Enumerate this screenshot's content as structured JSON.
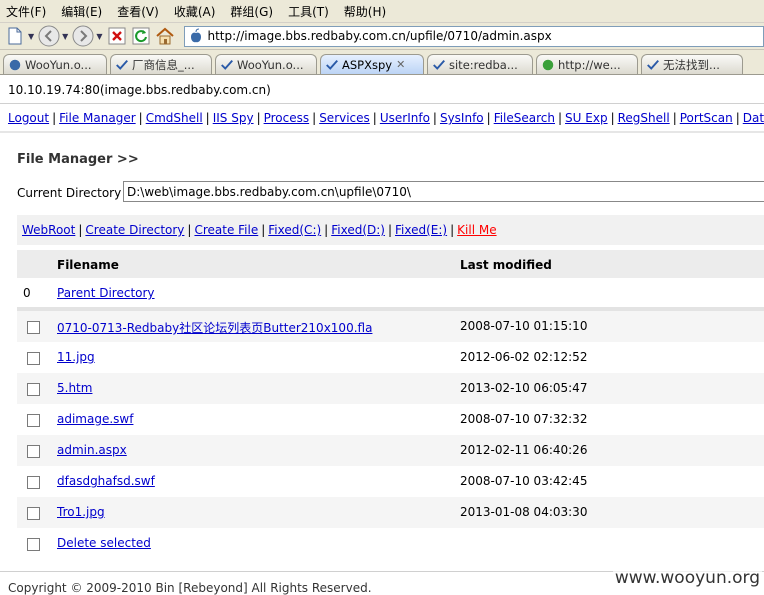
{
  "menu": [
    "文件(F)",
    "编辑(E)",
    "查看(V)",
    "收藏(A)",
    "群组(G)",
    "工具(T)",
    "帮助(H)"
  ],
  "address": {
    "url": "http://image.bbs.redbaby.com.cn/upfile/0710/admin.aspx"
  },
  "tabs": [
    {
      "label": "WooYun.o...",
      "active": false
    },
    {
      "label": "厂商信息_...",
      "active": false
    },
    {
      "label": "WooYun.o...",
      "active": false
    },
    {
      "label": "ASPXspy",
      "active": true
    },
    {
      "label": "site:redba...",
      "active": false
    },
    {
      "label": "http://we...",
      "active": false
    },
    {
      "label": "无法找到...",
      "active": false
    }
  ],
  "host": "10.10.19.74:80(image.bbs.redbaby.com.cn)",
  "nav": [
    "Logout",
    "File Manager",
    "CmdShell",
    "IIS Spy",
    "Process",
    "Services",
    "UserInfo",
    "SysInfo",
    "FileSearch",
    "SU Exp",
    "RegShell",
    "PortScan",
    "DataBase"
  ],
  "fm": {
    "title": "File Manager >>",
    "current_dir_label": "Current Directory :",
    "current_dir_value": "D:\\web\\image.bbs.redbaby.com.cn\\upfile\\0710\\",
    "quick": [
      "WebRoot",
      "Create Directory",
      "Create File",
      "Fixed(C:)",
      "Fixed(D:)",
      "Fixed(E:)"
    ],
    "kill": "Kill Me",
    "col_filename": "Filename",
    "col_modified": "Last modified",
    "parent_num": "0",
    "parent_label": "Parent Directory",
    "files": [
      {
        "name": "0710-0713-Redbaby社区论坛列表页Butter210x100.fla",
        "date": "2008-07-10 01:15:10"
      },
      {
        "name": "11.jpg",
        "date": "2012-06-02 02:12:52"
      },
      {
        "name": "5.htm",
        "date": "2013-02-10 06:05:47"
      },
      {
        "name": "adimage.swf",
        "date": "2008-07-10 07:32:32"
      },
      {
        "name": "admin.aspx",
        "date": "2012-02-11 06:40:26"
      },
      {
        "name": "dfasdghafsd.swf",
        "date": "2008-07-10 03:42:45"
      },
      {
        "name": "Tro1.jpg",
        "date": "2013-01-08 04:03:30"
      }
    ],
    "delete_label": "Delete selected"
  },
  "copyright": "Copyright © 2009-2010 Bin [Rebeyond] All Rights Reserved.",
  "watermark": "www.wooyun.org"
}
